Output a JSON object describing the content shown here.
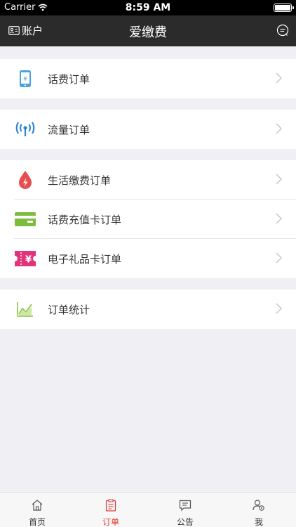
{
  "status_bar": {
    "carrier": "Carrier",
    "time": "8:59 AM"
  },
  "nav": {
    "account_label": "账户",
    "title": "爱缴费"
  },
  "groups": [
    {
      "items": [
        {
          "label": "话费订单",
          "icon": "phone-yuan-icon"
        }
      ]
    },
    {
      "items": [
        {
          "label": "流量订单",
          "icon": "signal-broadcast-icon"
        }
      ]
    },
    {
      "items": [
        {
          "label": "生活缴费订单",
          "icon": "drop-bolt-icon"
        },
        {
          "label": "话费充值卡订单",
          "icon": "recharge-card-icon"
        },
        {
          "label": "电子礼品卡订单",
          "icon": "gift-card-icon"
        }
      ]
    },
    {
      "items": [
        {
          "label": "订单统计",
          "icon": "line-chart-icon"
        }
      ]
    }
  ],
  "tabs": [
    {
      "label": "首页",
      "icon": "home-icon",
      "active": false
    },
    {
      "label": "订单",
      "icon": "clipboard-icon",
      "active": true
    },
    {
      "label": "公告",
      "icon": "announcement-icon",
      "active": false
    },
    {
      "label": "我",
      "icon": "user-settings-icon",
      "active": false
    }
  ],
  "colors": {
    "accent": "#e03a3a",
    "navbar": "#2b2b2b",
    "background": "#efeff4"
  }
}
